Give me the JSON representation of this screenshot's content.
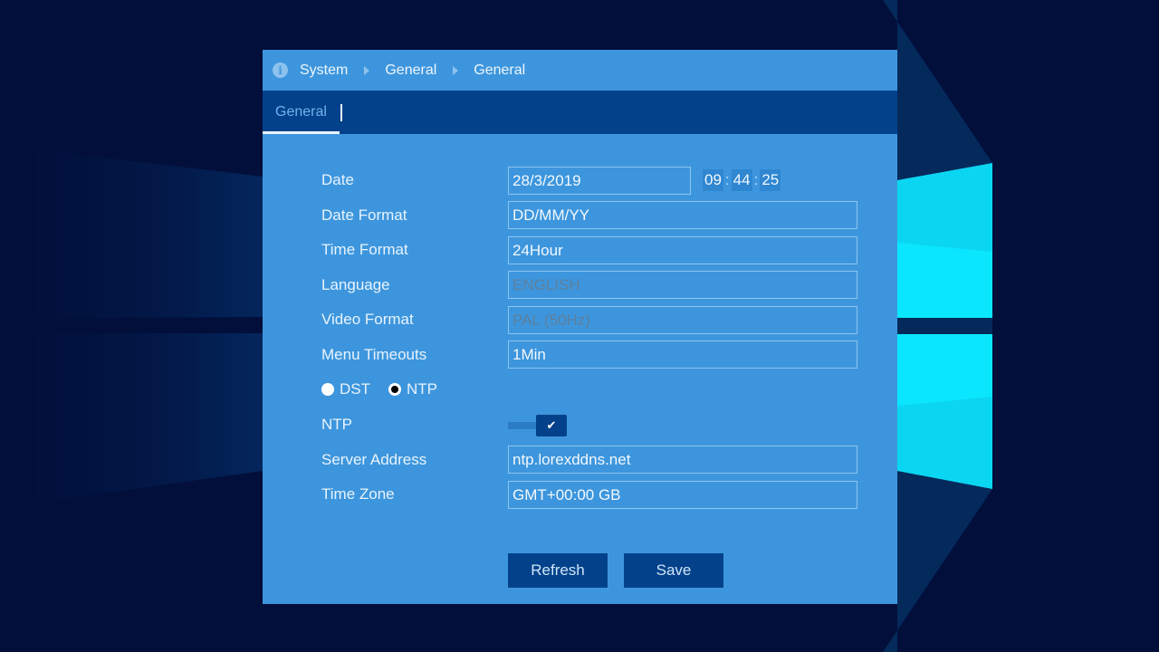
{
  "colors": {
    "panel": "#3d96dd",
    "tabbar": "#03428a",
    "button": "#03428a",
    "desktop_bg": "#020f3a",
    "logo": "#0be3fb"
  },
  "breadcrumb": {
    "icon": "info-icon",
    "items": [
      "System",
      "General",
      "General"
    ],
    "separator_icon": "triangle-right-icon"
  },
  "tabs": [
    {
      "label": "General",
      "active": true
    }
  ],
  "form": {
    "date": {
      "label": "Date",
      "value": "28/3/2019"
    },
    "time": {
      "hour": "09",
      "minute": "44",
      "second": "25",
      "separator": ":"
    },
    "date_format": {
      "label": "Date Format",
      "value": "DD/MM/YY"
    },
    "time_format": {
      "label": "Time Format",
      "value": "24Hour"
    },
    "language": {
      "label": "Language",
      "value": "ENGLISH",
      "disabled": true
    },
    "video_format": {
      "label": "Video Format",
      "value": "PAL (50Hz)",
      "disabled": true
    },
    "menu_timeouts": {
      "label": "Menu Timeouts",
      "value": "1Min"
    },
    "radios": [
      {
        "label": "DST",
        "checked": false
      },
      {
        "label": "NTP",
        "checked": true
      }
    ],
    "ntp": {
      "label": "NTP",
      "enabled": true,
      "check_icon": "✔"
    },
    "server_address": {
      "label": "Server Address",
      "value": "ntp.lorexddns.net"
    },
    "time_zone": {
      "label": "Time Zone",
      "value": "GMT+00:00 GB"
    }
  },
  "buttons": {
    "refresh": "Refresh",
    "save": "Save"
  }
}
